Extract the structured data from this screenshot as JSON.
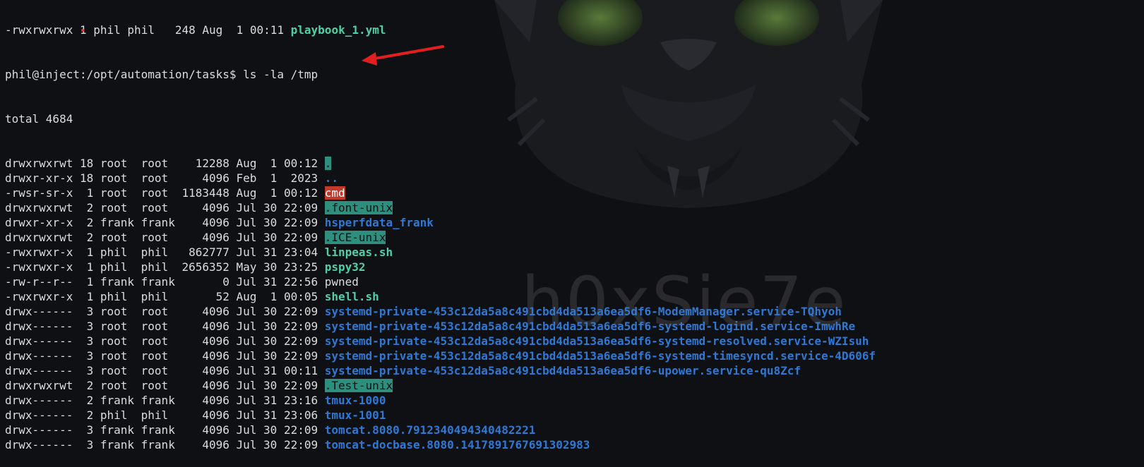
{
  "terminal": {
    "partial_top": {
      "perm": "-rwxrwxrwx",
      "links": "1",
      "owner": "phil",
      "group": "phil",
      "size": "248",
      "date": "Aug  1 00:11",
      "name": "playbook_1.yml"
    },
    "prompt": "phil@inject:/opt/automation/tasks$ ls -la /tmp",
    "total": "total 4684",
    "entries": [
      {
        "meta": "drwxrwxrwt 18 root  root    12288 Aug  1 00:12 ",
        "name": ".",
        "style": "hl-green"
      },
      {
        "meta": "drwxr-xr-x 18 root  root     4096 Feb  1  2023 ",
        "name": "..",
        "style": "dir"
      },
      {
        "meta": "-rwsr-sr-x  1 root  root  1183448 Aug  1 00:12 ",
        "name": "cmd",
        "style": "hl-red"
      },
      {
        "meta": "drwxrwxrwt  2 root  root     4096 Jul 30 22:09 ",
        "name": ".font-unix",
        "style": "hl-green"
      },
      {
        "meta": "drwxr-xr-x  2 frank frank    4096 Jul 30 22:09 ",
        "name": "hsperfdata_frank",
        "style": "dir"
      },
      {
        "meta": "drwxrwxrwt  2 root  root     4096 Jul 30 22:09 ",
        "name": ".ICE-unix",
        "style": "hl-green"
      },
      {
        "meta": "-rwxrwxr-x  1 phil  phil   862777 Jul 31 23:04 ",
        "name": "linpeas.sh",
        "style": "exec"
      },
      {
        "meta": "-rwxrwxr-x  1 phil  phil  2656352 May 30 23:25 ",
        "name": "pspy32",
        "style": "exec"
      },
      {
        "meta": "-rw-r--r--  1 frank frank       0 Jul 31 22:56 ",
        "name": "pwned",
        "style": "plain"
      },
      {
        "meta": "-rwxrwxr-x  1 phil  phil       52 Aug  1 00:05 ",
        "name": "shell.sh",
        "style": "exec"
      },
      {
        "meta": "drwx------  3 root  root     4096 Jul 30 22:09 ",
        "name": "systemd-private-453c12da5a8c491cbd4da513a6ea5df6-ModemManager.service-TQhyoh",
        "style": "dir"
      },
      {
        "meta": "drwx------  3 root  root     4096 Jul 30 22:09 ",
        "name": "systemd-private-453c12da5a8c491cbd4da513a6ea5df6-systemd-logind.service-ImwhRe",
        "style": "dir"
      },
      {
        "meta": "drwx------  3 root  root     4096 Jul 30 22:09 ",
        "name": "systemd-private-453c12da5a8c491cbd4da513a6ea5df6-systemd-resolved.service-WZIsuh",
        "style": "dir"
      },
      {
        "meta": "drwx------  3 root  root     4096 Jul 30 22:09 ",
        "name": "systemd-private-453c12da5a8c491cbd4da513a6ea5df6-systemd-timesyncd.service-4D606f",
        "style": "dir"
      },
      {
        "meta": "drwx------  3 root  root     4096 Jul 31 00:11 ",
        "name": "systemd-private-453c12da5a8c491cbd4da513a6ea5df6-upower.service-qu8Zcf",
        "style": "dir"
      },
      {
        "meta": "drwxrwxrwt  2 root  root     4096 Jul 30 22:09 ",
        "name": ".Test-unix",
        "style": "hl-green"
      },
      {
        "meta": "drwx------  2 frank frank    4096 Jul 31 23:16 ",
        "name": "tmux-1000",
        "style": "dir"
      },
      {
        "meta": "drwx------  2 phil  phil     4096 Jul 31 23:06 ",
        "name": "tmux-1001",
        "style": "dir"
      },
      {
        "meta": "drwx------  3 frank frank    4096 Jul 30 22:09 ",
        "name": "tomcat.8080.7912340494340482221",
        "style": "dir"
      },
      {
        "meta": "drwx------  3 frank frank    4096 Jul 30 22:09 ",
        "name": "tomcat-docbase.8080.1417891767691302983",
        "style": "dir"
      }
    ]
  },
  "watermark": "h0xSie7e",
  "colors": {
    "background": "#0f1013",
    "text": "#dcdcdc",
    "dir": "#2f78d4",
    "exec": "#4fd1a5",
    "hl_green": "#2f8f7f",
    "hl_red": "#c0392b",
    "arrow": "#e02020"
  },
  "icons": {
    "background_art": "cat-face-icon",
    "annotation": "red-arrow-icon"
  }
}
